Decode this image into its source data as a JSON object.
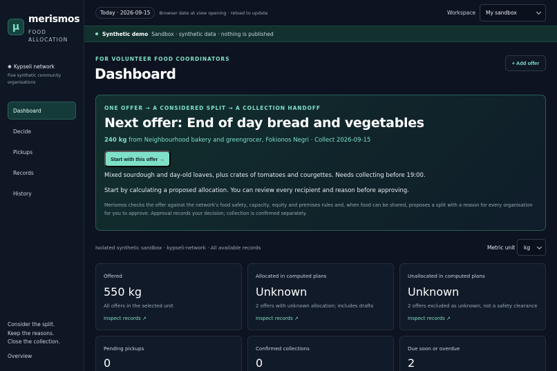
{
  "brand": {
    "logo_glyph": "µ",
    "name": "merismos",
    "sub_line1": "FOOD",
    "sub_line2": "ALLOCATION"
  },
  "network": {
    "dot": "✺",
    "name": "Kypseli network",
    "desc": "Five synthetic community organisations"
  },
  "nav": [
    {
      "label": "Dashboard",
      "active": true
    },
    {
      "label": "Decide"
    },
    {
      "label": "Pickups"
    },
    {
      "label": "Records"
    },
    {
      "label": "History"
    }
  ],
  "sidebar_footer": {
    "lines": [
      "Consider the split.",
      "Keep the reasons.",
      "Close the collection."
    ],
    "overview": "Overview"
  },
  "topbar": {
    "date_pill": "Today · 2026-09-15",
    "date_note": "Browser date at view opening · reload to update",
    "workspace_label": "Workspace",
    "workspace_value": "My sandbox"
  },
  "banner": {
    "strong": "Synthetic demo",
    "text": "Sandbox · synthetic data · nothing is published"
  },
  "header": {
    "eyebrow": "FOR VOLUNTEER FOOD COORDINATORS",
    "title": "Dashboard",
    "add_offer": "+ Add offer"
  },
  "hero": {
    "eyebrow": "ONE OFFER → A CONSIDERED SPLIT → A COLLECTION HANDOFF",
    "title": "Next offer: End of day bread and vegetables",
    "qty": "240 kg",
    "meta_rest": " from Neighbourhood bakery and greengrocer, Fokionos Negri · Collect 2026-09-15",
    "cta": "Start with this offer →",
    "desc": "Mixed sourdough and day-old loaves, plus crates of tomatoes and courgettes. Needs collecting before 19:00.",
    "start": "Start by calculating a proposed allocation. You can review every recipient and reason before approving.",
    "fine": "Merismos checks the offer against the network's food safety, capacity, equity and premises rules and, when food can be shared, proposes a split with a reason for every organisation for you to approve. Approval records your decision; collection is confirmed separately."
  },
  "scope": "Isolated synthetic sandbox · kypseli-network · All available records",
  "metric": {
    "label": "Metric unit",
    "value": "kg"
  },
  "cards": [
    {
      "label": "Offered",
      "value": "550 kg",
      "sub": "All offers in the selected unit",
      "link": "Inspect records ↗"
    },
    {
      "label": "Allocated in computed plans",
      "value": "Unknown",
      "sub": "2 offers with unknown allocation; includes drafts",
      "link": "Inspect records ↗"
    },
    {
      "label": "Unallocated in computed plans",
      "value": "Unknown",
      "sub": "2 offers excluded as unknown; not a safety clearance",
      "link": "Inspect records ↗"
    },
    {
      "label": "Pending pickups",
      "value": "0"
    },
    {
      "label": "Confirmed collections",
      "value": "0"
    },
    {
      "label": "Due soon or overdue",
      "value": "2"
    }
  ]
}
